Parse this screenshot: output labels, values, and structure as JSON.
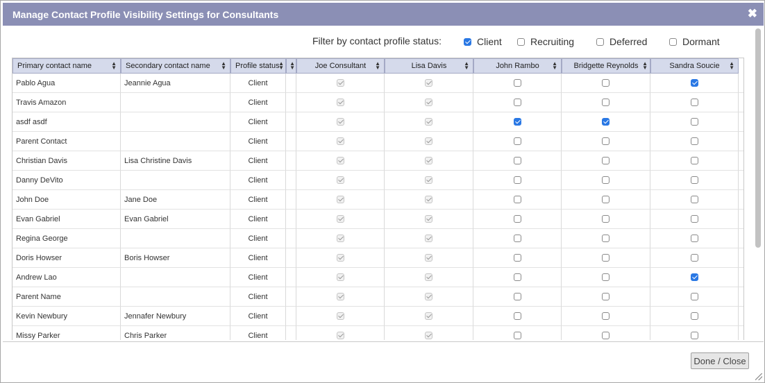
{
  "dialog": {
    "title": "Manage Contact Profile Visibility Settings for Consultants",
    "close_glyph": "✖",
    "done_label": "Done / Close"
  },
  "filter": {
    "label": "Filter by contact profile status:",
    "options": [
      {
        "label": "Client",
        "checked": true
      },
      {
        "label": "Recruiting",
        "checked": false
      },
      {
        "label": "Deferred",
        "checked": false
      },
      {
        "label": "Dormant",
        "checked": false
      }
    ]
  },
  "table": {
    "columns": [
      "Primary contact name",
      "Secondary contact name",
      "Profile status"
    ],
    "consultants": [
      "Joe Consultant",
      "Lisa Davis",
      "John Rambo",
      "Bridgette Reynolds",
      "Sandra Soucie"
    ],
    "rows": [
      {
        "primary": "Pablo Agua",
        "secondary": "Jeannie Agua",
        "status": "Client",
        "vis": [
          true,
          true,
          false,
          false,
          true
        ]
      },
      {
        "primary": "Travis Amazon",
        "secondary": "",
        "status": "Client",
        "vis": [
          true,
          true,
          false,
          false,
          false
        ]
      },
      {
        "primary": "asdf asdf",
        "secondary": "",
        "status": "Client",
        "vis": [
          true,
          true,
          true,
          true,
          false
        ]
      },
      {
        "primary": "Parent Contact",
        "secondary": "",
        "status": "Client",
        "vis": [
          true,
          true,
          false,
          false,
          false
        ]
      },
      {
        "primary": "Christian Davis",
        "secondary": "Lisa Christine Davis",
        "status": "Client",
        "vis": [
          true,
          true,
          false,
          false,
          false
        ]
      },
      {
        "primary": "Danny DeVito",
        "secondary": "",
        "status": "Client",
        "vis": [
          true,
          true,
          false,
          false,
          false
        ]
      },
      {
        "primary": "John Doe",
        "secondary": "Jane Doe",
        "status": "Client",
        "vis": [
          true,
          true,
          false,
          false,
          false
        ]
      },
      {
        "primary": "Evan Gabriel",
        "secondary": "Evan Gabriel",
        "status": "Client",
        "vis": [
          true,
          true,
          false,
          false,
          false
        ]
      },
      {
        "primary": "Regina George",
        "secondary": "",
        "status": "Client",
        "vis": [
          true,
          true,
          false,
          false,
          false
        ]
      },
      {
        "primary": "Doris Howser",
        "secondary": "Boris Howser",
        "status": "Client",
        "vis": [
          true,
          true,
          false,
          false,
          false
        ]
      },
      {
        "primary": "Andrew Lao",
        "secondary": "",
        "status": "Client",
        "vis": [
          true,
          true,
          false,
          false,
          true
        ]
      },
      {
        "primary": "Parent Name",
        "secondary": "",
        "status": "Client",
        "vis": [
          true,
          true,
          false,
          false,
          false
        ]
      },
      {
        "primary": "Kevin Newbury",
        "secondary": "Jennafer Newbury",
        "status": "Client",
        "vis": [
          true,
          true,
          false,
          false,
          false
        ]
      },
      {
        "primary": "Missy Parker",
        "secondary": "Chris Parker",
        "status": "Client",
        "vis": [
          true,
          true,
          false,
          false,
          false
        ]
      }
    ]
  },
  "colors": {
    "titlebar": "#8b8fb5",
    "header": "#d5daeb",
    "checkbox_checked": "#2a78e4"
  }
}
